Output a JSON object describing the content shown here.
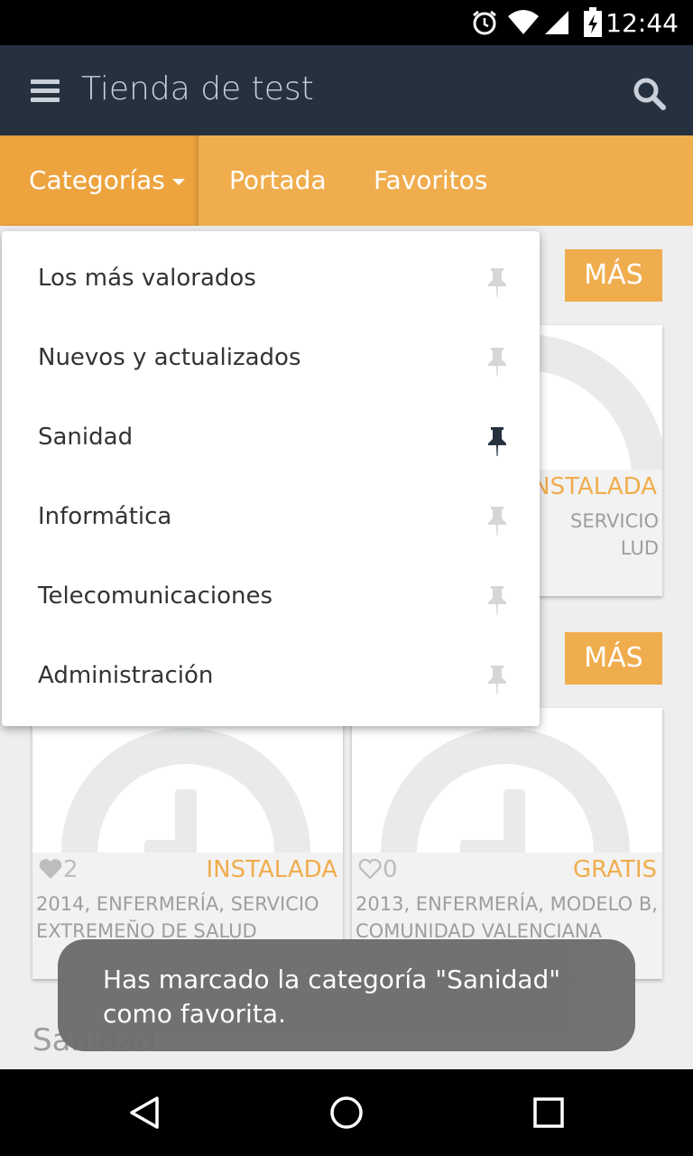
{
  "status_bar": {
    "time": "12:44"
  },
  "app_bar": {
    "title": "Tienda de test"
  },
  "tabs": {
    "categorias": "Categorías",
    "portada": "Portada",
    "favoritos": "Favoritos"
  },
  "dropdown": {
    "items": [
      {
        "label": "Los más valorados",
        "pinned": false
      },
      {
        "label": "Nuevos y actualizados",
        "pinned": false
      },
      {
        "label": "Sanidad",
        "pinned": true
      },
      {
        "label": "Informática",
        "pinned": false
      },
      {
        "label": "Telecomunicaciones",
        "pinned": false
      },
      {
        "label": "Administración",
        "pinned": false
      }
    ]
  },
  "content": {
    "more_label_1": "MÁS",
    "more_label_2": "MÁS",
    "top_card": {
      "status": "INSTALADA",
      "desc_line1": "SERVICIO",
      "desc_line2": "LUD"
    },
    "cards": [
      {
        "likes": "2",
        "liked": true,
        "status": "INSTALADA",
        "desc_line1": "2014, ENFERMERÍA, SERVICIO",
        "desc_line2": "EXTREMEÑO DE SALUD"
      },
      {
        "likes": "0",
        "liked": false,
        "status": "GRATIS",
        "desc_line1": "2013, ENFERMERÍA, MODELO B,",
        "desc_line2": "COMUNIDAD VALENCIANA"
      }
    ],
    "section_title": "Sanidad"
  },
  "toast": {
    "message": "Has marcado la categoría \"Sanidad\" como favorita."
  },
  "colors": {
    "accent": "#f0ad4e",
    "appbar": "#263140",
    "pin_active": "#263140",
    "pin_inactive": "#d6d6d6"
  }
}
